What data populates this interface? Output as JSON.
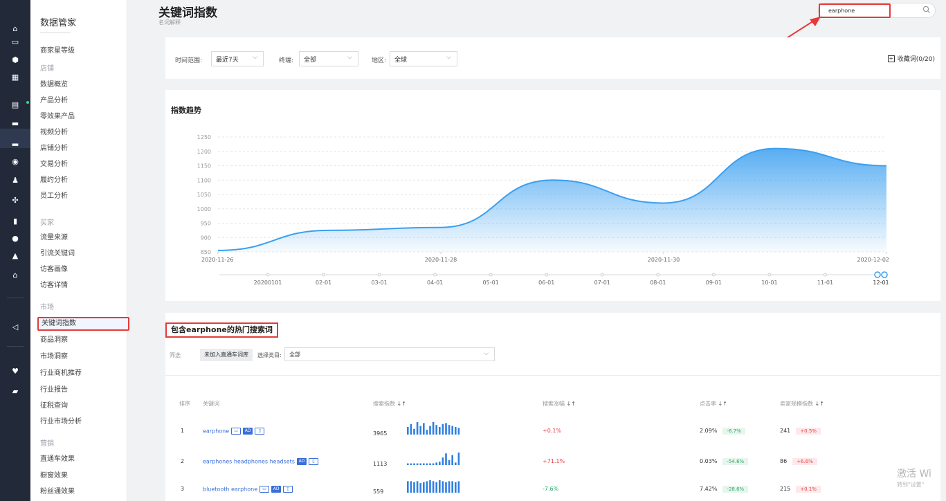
{
  "rail": {
    "icons": [
      "home-icon",
      "shop-icon",
      "shield-icon",
      "grid-icon",
      "store-icon",
      "chat-icon",
      "chart-icon",
      "lightbulb-icon",
      "users-icon",
      "plus-minus-icon",
      "clipboard-icon",
      "circle-icon",
      "bell-icon",
      "bank-icon",
      "send-icon",
      "heart-icon",
      "bag-icon"
    ]
  },
  "nav": {
    "brand": "数据管家",
    "items": [
      {
        "type": "item",
        "label": "商家星等级"
      },
      {
        "type": "section",
        "label": "店铺"
      },
      {
        "type": "item",
        "label": "数据概览"
      },
      {
        "type": "item",
        "label": "产品分析"
      },
      {
        "type": "item",
        "label": "零效果产品"
      },
      {
        "type": "item",
        "label": "视频分析"
      },
      {
        "type": "item",
        "label": "店铺分析"
      },
      {
        "type": "item",
        "label": "交易分析"
      },
      {
        "type": "item",
        "label": "履约分析"
      },
      {
        "type": "item",
        "label": "员工分析"
      },
      {
        "type": "section",
        "label": "买家"
      },
      {
        "type": "item",
        "label": "流量来源"
      },
      {
        "type": "item",
        "label": "引流关键词"
      },
      {
        "type": "item",
        "label": "访客画像"
      },
      {
        "type": "item",
        "label": "访客详情"
      },
      {
        "type": "section",
        "label": "市场"
      },
      {
        "type": "item",
        "label": "关键词指数",
        "selected": true
      },
      {
        "type": "item",
        "label": "商品洞察"
      },
      {
        "type": "item",
        "label": "市场洞察"
      },
      {
        "type": "item",
        "label": "行业商机推荐"
      },
      {
        "type": "item",
        "label": "行业报告"
      },
      {
        "type": "item",
        "label": "征税查询"
      },
      {
        "type": "item",
        "label": "行业市场分析"
      },
      {
        "type": "section",
        "label": "营销"
      },
      {
        "type": "item",
        "label": "直通车效果"
      },
      {
        "type": "item",
        "label": "橱窗效果"
      },
      {
        "type": "item",
        "label": "粉丝通效果"
      }
    ]
  },
  "header": {
    "title": "关键词指数",
    "subtitle": "名词解释",
    "search_value": "earphone"
  },
  "filters": {
    "time_label": "时间范围:",
    "time_value": "最近7天",
    "device_label": "终端:",
    "device_value": "全部",
    "region_label": "地区:",
    "region_value": "全球",
    "favorite": "收藏词(0/20)"
  },
  "chart_section": {
    "title": "指数趋势",
    "timeline_labels": [
      "20200101",
      "02-01",
      "03-01",
      "04-01",
      "05-01",
      "06-01",
      "07-01",
      "08-01",
      "09-01",
      "10-01",
      "11-01",
      "12-01"
    ],
    "timeline_selected": "12-01"
  },
  "chart_data": {
    "type": "area",
    "x": [
      "2020-11-26",
      "2020-11-27",
      "2020-11-28",
      "2020-11-29",
      "2020-11-30",
      "2020-12-01",
      "2020-12-02"
    ],
    "x_tick_labels": [
      "2020-11-26",
      "2020-11-28",
      "2020-11-30",
      "2020-12-02"
    ],
    "series": [
      {
        "values": [
          855,
          925,
          935,
          1100,
          1020,
          1210,
          1150
        ]
      }
    ],
    "y_ticks": [
      850,
      900,
      950,
      1000,
      1050,
      1100,
      1150,
      1200,
      1250
    ],
    "ylim": [
      850,
      1250
    ],
    "grid": true,
    "color": "#3a9ff0"
  },
  "table_section": {
    "title": "包含earphone的热门搜索词",
    "filter_label": "筛选",
    "filter_chip": "未加入直通车词库",
    "category_label": "选择类目:",
    "category_value": "全部",
    "columns": [
      "排序",
      "关键词",
      "搜索指数",
      "搜索涨幅",
      "点击率",
      "卖家规模指数"
    ],
    "rows": [
      {
        "rank": "1",
        "keyword": "earphone",
        "badges": [
          "pc",
          "AD",
          "mobile"
        ],
        "search_index": "3965",
        "spark": [
          8,
          11,
          6,
          13,
          9,
          12,
          5,
          9,
          13,
          10,
          8,
          11,
          12,
          10,
          9,
          8,
          7
        ],
        "growth": "+0.1%",
        "growth_dir": "up",
        "ctr": "2.09%",
        "ctr_change": "-6.7%",
        "seller": "241",
        "seller_change": "+0.5%"
      },
      {
        "rank": "2",
        "keyword": "earphones headphones headsets",
        "badges": [
          "AD",
          "mobile"
        ],
        "search_index": "1113",
        "spark": [
          2,
          2,
          2,
          2,
          2,
          2,
          2,
          2,
          2,
          3,
          4,
          9,
          14,
          6,
          12,
          3,
          15
        ],
        "growth": "+71.1%",
        "growth_dir": "up",
        "ctr": "0.03%",
        "ctr_change": "-54.6%",
        "seller": "86",
        "seller_change": "+6.6%"
      },
      {
        "rank": "3",
        "keyword": "bluetooth earphone",
        "badges": [
          "pc",
          "AD",
          "mobile"
        ],
        "search_index": "559",
        "spark": [
          12,
          12,
          11,
          12,
          10,
          11,
          12,
          13,
          12,
          11,
          13,
          12,
          11,
          12,
          12,
          11,
          12
        ],
        "growth": "-7.6%",
        "growth_dir": "down",
        "ctr": "7.42%",
        "ctr_change": "-28.6%",
        "seller": "215",
        "seller_change": "+0.1%"
      }
    ]
  },
  "watermark": {
    "line1": "激活 Wi",
    "line2": "转到\"设置\""
  }
}
